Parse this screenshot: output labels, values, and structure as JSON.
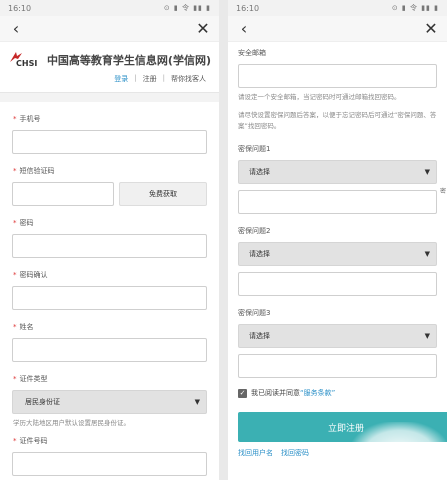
{
  "left": {
    "status": {
      "time": "16:10",
      "icons": "⊙ ▮ 令 ▮▮ ▮"
    },
    "nav": {
      "back": "‹",
      "close": "✕"
    },
    "logo": {
      "text": "CHSI",
      "site_name": "中国高等教育学生信息网(学信网)"
    },
    "toplinks": {
      "login": "登录",
      "register": "注册",
      "help": "帮你找客人",
      "sep": "|"
    },
    "fields": {
      "phone_label": "手机号",
      "sms_label": "短信验证码",
      "sms_button": "免费获取",
      "password_label": "密码",
      "password_confirm_label": "密码确认",
      "name_label": "姓名",
      "id_type_label": "证件类型",
      "id_type_value": "居民身份证",
      "id_type_hint": "学历大陆地区用户默认设置居民身份证。",
      "id_number_label": "证件号码"
    }
  },
  "right": {
    "status": {
      "time": "16:10",
      "icons": "⊙ ▮ 令 ▮▮ ▮"
    },
    "nav": {
      "back": "‹",
      "close": "✕"
    },
    "email_label": "安全邮箱",
    "email_hint": "请设定一个安全邮箱，当记密码时可通过邮箱找回密码。",
    "question_hint": "请尽快设置密保问题后答案，以便于忘记密码后可通过“密保问题、答案”找回密码。",
    "q1_label": "密保问题1",
    "q2_label": "密保问题2",
    "q3_label": "密保问题3",
    "select_placeholder": "请选择",
    "agree_text": "我已阅读并同意",
    "agree_link": "“服务条款”",
    "submit": "立即注册",
    "find_user": "找回用户名",
    "find_password": "找回密码",
    "edge_char": "密"
  },
  "colors": {
    "accent": "#3bb0b3",
    "link": "#2a8fc7"
  }
}
